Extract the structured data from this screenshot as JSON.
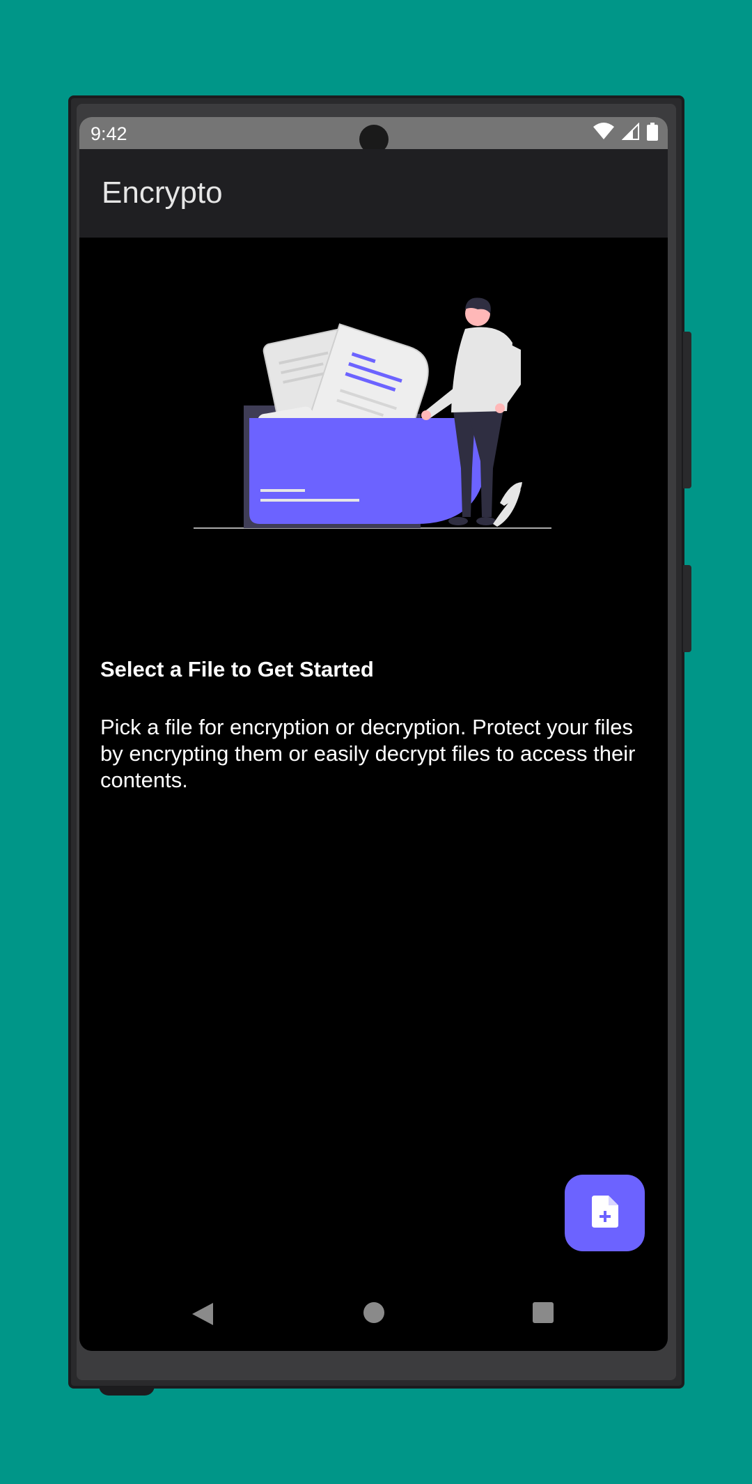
{
  "status_bar": {
    "time": "9:42",
    "icons": [
      "wifi-icon",
      "cell-signal-icon",
      "battery-icon"
    ]
  },
  "app_bar": {
    "title": "Encrypto"
  },
  "empty_state": {
    "illustration": "file-folder-person-illustration",
    "heading": "Select a File to Get Started",
    "description": "Pick a file for encryption or decryption. Protect your files by encrypting them or easily decrypt files to access their contents."
  },
  "fab": {
    "icon": "file-add-icon"
  },
  "nav_bar": {
    "items": [
      "back-icon",
      "home-icon",
      "recents-icon"
    ]
  },
  "colors": {
    "background": "#009688",
    "accent": "#6c63ff",
    "app_bar": "#1f1f22",
    "status_bar": "#757575",
    "screen": "#000000"
  }
}
